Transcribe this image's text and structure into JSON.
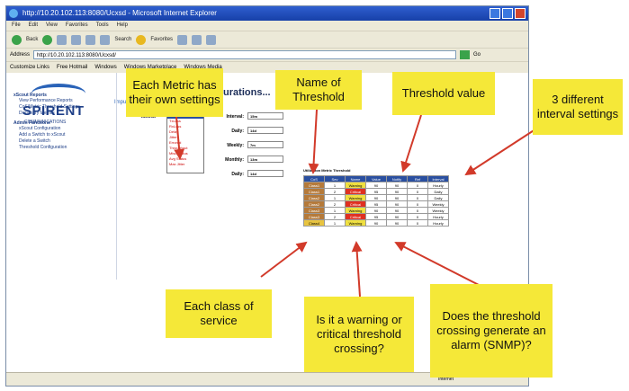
{
  "browser": {
    "title": "http://10.20.102.113:8080/Ucxsd - Microsoft Internet Explorer",
    "menus": [
      "File",
      "Edit",
      "View",
      "Favorites",
      "Tools",
      "Help"
    ],
    "back_label": "Back",
    "search_label": "Search",
    "favorites_label": "Favorites",
    "address_label": "Address",
    "address_value": "http://10.20.102.113:8080/Ucxsd/",
    "go_label": "Go",
    "links": [
      "Customize Links",
      "Free Hotmail",
      "Windows",
      "Windows Marketplace",
      "Windows Media"
    ],
    "status_text": "Internet"
  },
  "app": {
    "logo_text": "SPIRENT",
    "logo_sub": "COMMUNICATIONS",
    "nav_hint": "Impuls",
    "sidebar": {
      "section1": "xScout Reports",
      "items1": [
        "View Performance Reports",
        "CoS/Metric Threshold Settings",
        "Dictionary Metrics"
      ],
      "section2": "Admin Functions",
      "items2": [
        "xScout Configuration",
        "Add a Switch to xScout",
        "Delete a Switch",
        "Threshold Configuration"
      ]
    },
    "page_title": "Threshold Configurations...",
    "metric_label": "Metric:",
    "metric_options": [
      "Utilization",
      "TxLoss",
      "RxLoss",
      "Delay",
      "Jitter",
      "Errored",
      "Throughput",
      "Misc Status",
      "Avg Status",
      "Max Jitter"
    ],
    "intervals": [
      {
        "label": "Interval:",
        "value": "15m"
      },
      {
        "label": "Daily:",
        "value": "14d"
      },
      {
        "label": "Weekly:",
        "value": "7m"
      },
      {
        "label": "Monthly:",
        "value": "13m"
      },
      {
        "label": "Daily:",
        "value": "14d"
      }
    ],
    "threshold_caption": "Utilization Metric  Threshold",
    "table_headers": [
      "CoS",
      "Sev",
      "Name",
      "Value",
      "Notify",
      "Ref",
      "Interval"
    ],
    "table_rows": [
      [
        "Class1",
        "1",
        "Warning",
        "90",
        "90",
        "0",
        "Hourly"
      ],
      [
        "Class1",
        "2",
        "Critical",
        "95",
        "90",
        "0",
        "Daily"
      ],
      [
        "Class2",
        "1",
        "Warning",
        "90",
        "90",
        "0",
        "Daily"
      ],
      [
        "Class2",
        "2",
        "Critical",
        "95",
        "90",
        "0",
        "Weekly"
      ],
      [
        "Class3",
        "1",
        "Warning",
        "90",
        "90",
        "0",
        "Weekly"
      ],
      [
        "Class3",
        "2",
        "Critical",
        "95",
        "90",
        "0",
        "Hourly"
      ],
      [
        "Class4",
        "1",
        "Warning",
        "90",
        "90",
        "0",
        "Hourly"
      ]
    ]
  },
  "callouts": {
    "metric": "Each Metric has their own settings",
    "name": "Name of Threshold",
    "value": "Threshold value",
    "interval": "3 different interval settings",
    "class": "Each class of service",
    "severity": "Is it a warning or critical threshold crossing?",
    "alarm": "Does the threshold crossing generate an alarm (SNMP)?"
  },
  "colors": {
    "callout_bg": "#f5e838",
    "arrow": "#d23a2a",
    "header_blue": "#2a4fa0"
  }
}
